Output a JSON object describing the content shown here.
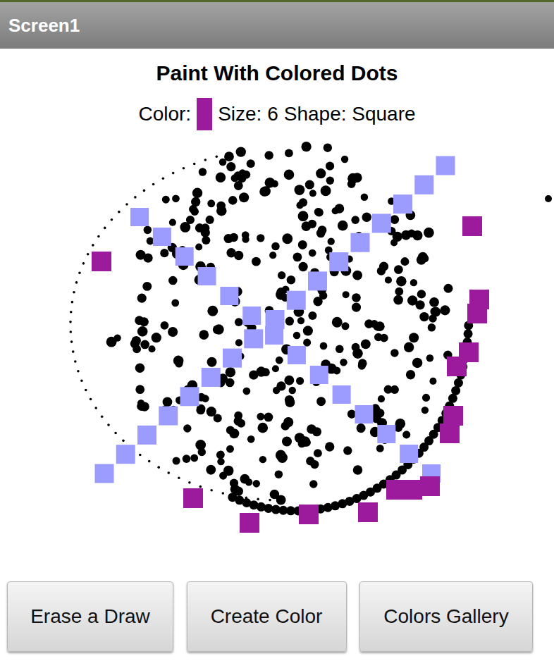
{
  "window": {
    "title": "Screen1"
  },
  "heading": "Paint With Colored Dots",
  "status": {
    "color_label": "Color:",
    "color": "#9c1a9c",
    "size": "Size: 6",
    "shape": "Shape: Square"
  },
  "canvas": {
    "strokes": [
      {
        "kind": "dots",
        "color": "#000000"
      },
      {
        "kind": "squares",
        "color": "#9c9cff"
      },
      {
        "kind": "squares",
        "color": "#9c1a9c"
      }
    ]
  },
  "buttons": [
    "Erase a Draw",
    "Create Color",
    "Colors Gallery"
  ]
}
